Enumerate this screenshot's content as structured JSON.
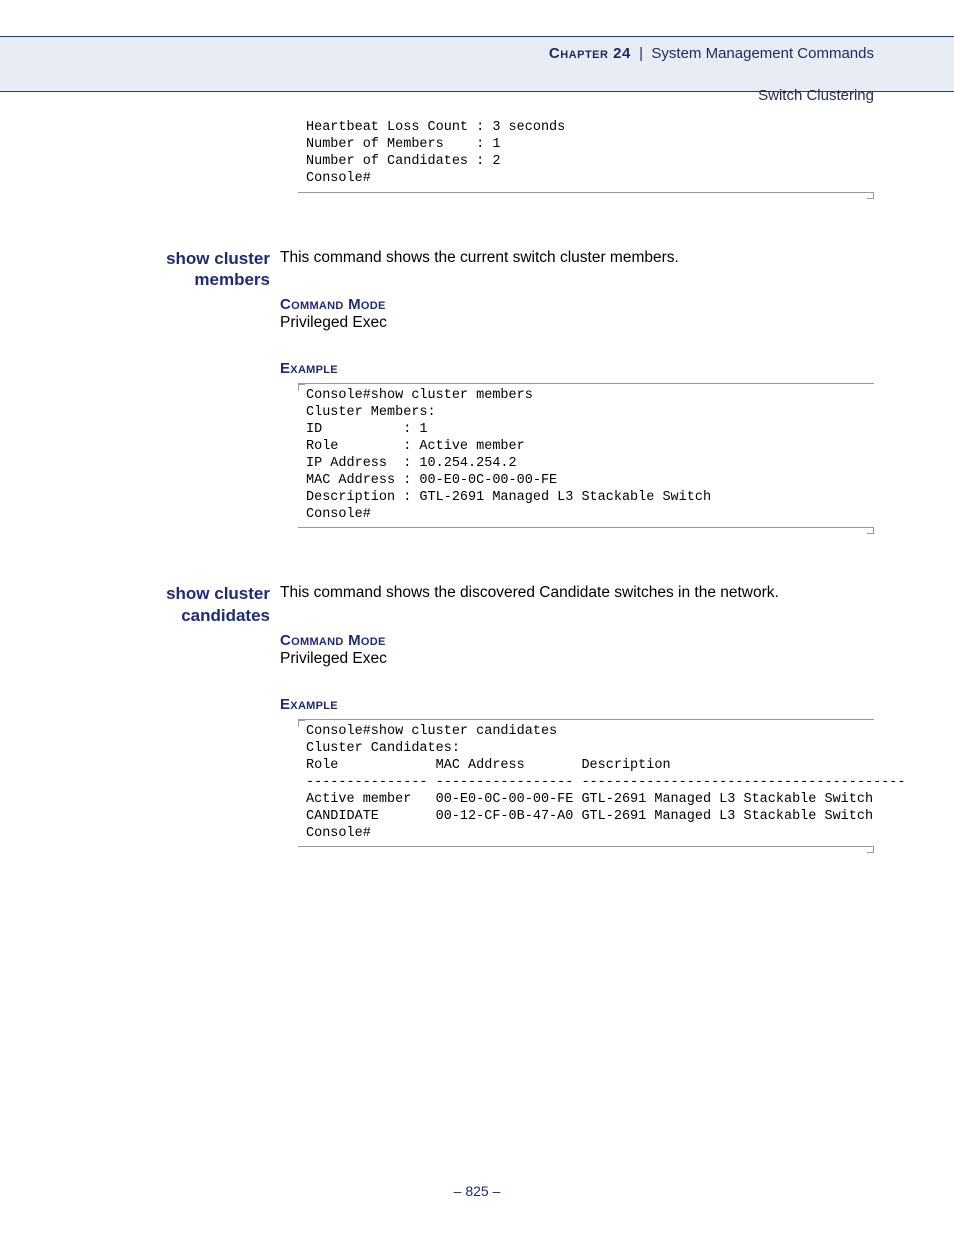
{
  "header": {
    "chapter_label": "Chapter 24",
    "separator": "  |  ",
    "chapter_title": "System Management Commands",
    "subtitle": "Switch Clustering"
  },
  "intro_code": "Heartbeat Loss Count : 3 seconds\nNumber of Members    : 1\nNumber of Candidates : 2\nConsole#",
  "sections": [
    {
      "name": "show cluster members",
      "desc": "This command shows the current switch cluster members.",
      "mode_label": "Command Mode",
      "mode_value": "Privileged Exec",
      "example_label": "Example",
      "example_code": "Console#show cluster members\nCluster Members:\nID          : 1\nRole        : Active member\nIP Address  : 10.254.254.2\nMAC Address : 00-E0-0C-00-00-FE\nDescription : GTL-2691 Managed L3 Stackable Switch\nConsole#"
    },
    {
      "name": "show cluster candidates",
      "desc": "This command shows the discovered Candidate switches in the network.",
      "mode_label": "Command Mode",
      "mode_value": "Privileged Exec",
      "example_label": "Example",
      "example_code": "Console#show cluster candidates\nCluster Candidates:\nRole            MAC Address       Description\n--------------- ----------------- ----------------------------------------\nActive member   00-E0-0C-00-00-FE GTL-2691 Managed L3 Stackable Switch\nCANDIDATE       00-12-CF-0B-47-A0 GTL-2691 Managed L3 Stackable Switch\nConsole#"
    }
  ],
  "page_number": "– 825 –"
}
